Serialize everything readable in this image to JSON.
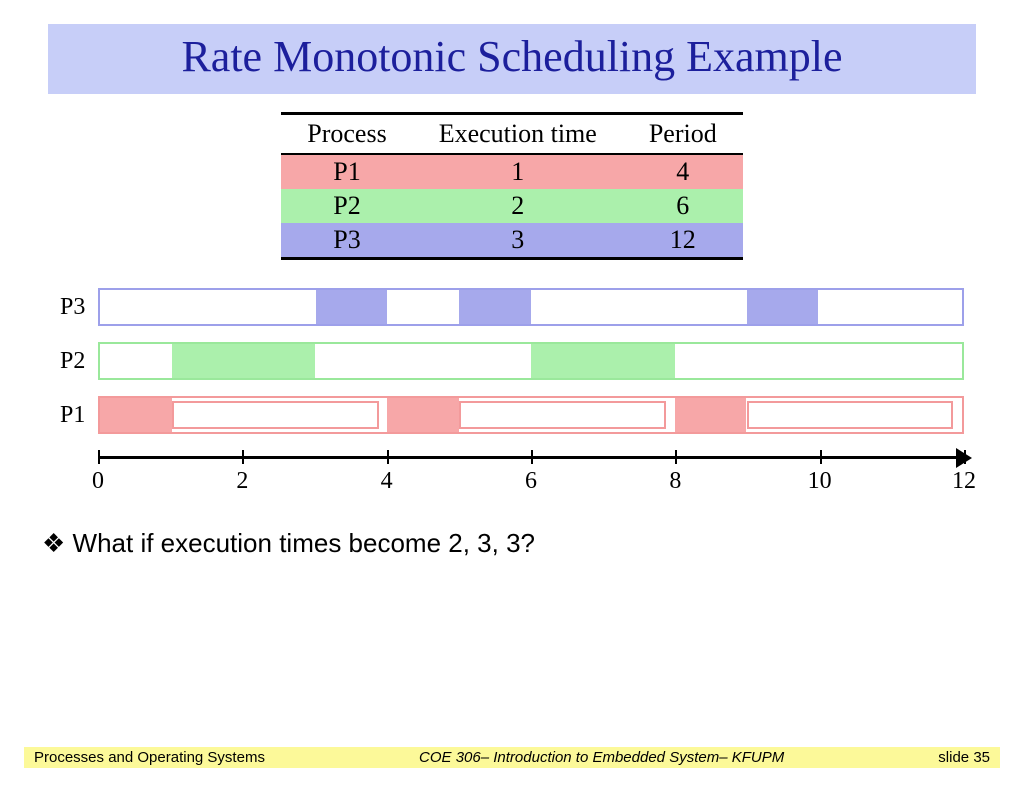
{
  "title": "Rate Monotonic Scheduling Example",
  "table": {
    "headers": [
      "Process",
      "Execution time",
      "Period"
    ],
    "rows": [
      {
        "id": "P1",
        "exec": 1,
        "period": 4,
        "color": "#f7a7a8"
      },
      {
        "id": "P2",
        "exec": 2,
        "period": 6,
        "color": "#abf0ac"
      },
      {
        "id": "P3",
        "exec": 3,
        "period": 12,
        "color": "#a6a9ec"
      }
    ]
  },
  "chart_data": {
    "type": "gantt",
    "time_range": [
      0,
      12
    ],
    "ticks": [
      0,
      2,
      4,
      6,
      8,
      10,
      12
    ],
    "tracks": [
      {
        "process": "P3",
        "color": "#a6a9ec",
        "run_intervals": [
          [
            3,
            4
          ],
          [
            5,
            6
          ],
          [
            9,
            10
          ]
        ],
        "periods": [
          [
            0,
            12
          ]
        ]
      },
      {
        "process": "P2",
        "color": "#abf0ac",
        "run_intervals": [
          [
            1,
            3
          ],
          [
            6,
            8
          ]
        ],
        "periods": [
          [
            0,
            6
          ],
          [
            6,
            12
          ]
        ]
      },
      {
        "process": "P1",
        "color": "#f7a7a8",
        "run_intervals": [
          [
            0,
            1
          ],
          [
            4,
            5
          ],
          [
            8,
            9
          ]
        ],
        "periods": [
          [
            0,
            4
          ],
          [
            4,
            8
          ],
          [
            8,
            12
          ]
        ]
      }
    ]
  },
  "question_bullet": "❖",
  "question": "What if execution times become 2, 3, 3?",
  "footer": {
    "left": "Processes and Operating Systems",
    "center": "COE 306– Introduction to Embedded System– KFUPM",
    "right": "slide 35"
  }
}
